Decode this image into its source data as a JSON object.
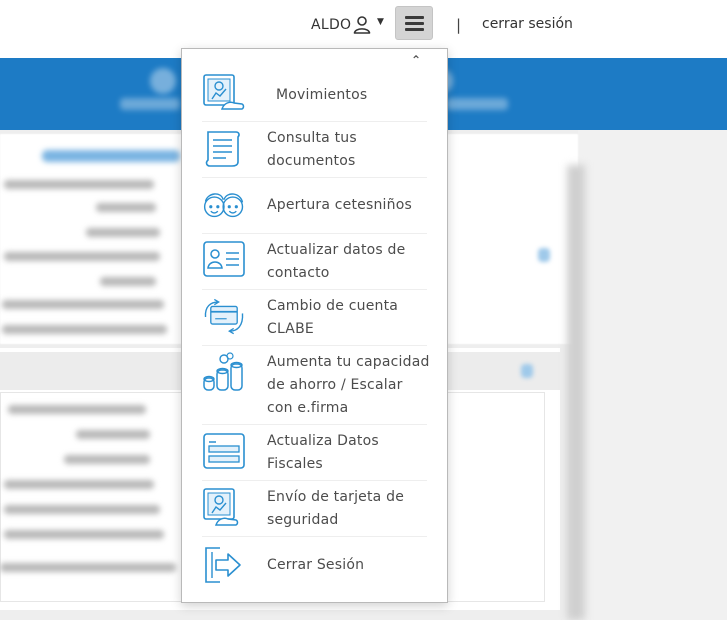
{
  "header": {
    "user_name": "ALDO",
    "user_icon": "user-icon",
    "dropdown_icon": "caret-down-icon",
    "menu_icon": "hamburger-menu-icon",
    "separator": "|",
    "logout_label": "cerrar sesión"
  },
  "menu": {
    "collapse_icon": "double-chevron-up-icon",
    "items": [
      {
        "label": "Movimientos",
        "icon": "movements-card-icon"
      },
      {
        "label": "Consulta tus documentos",
        "icon": "document-scroll-icon"
      },
      {
        "label": "Apertura cetesniños",
        "icon": "children-faces-icon"
      },
      {
        "label": "Actualizar datos de contacto",
        "icon": "contact-card-icon"
      },
      {
        "label": "Cambio de cuenta CLABE",
        "icon": "card-exchange-icon"
      },
      {
        "label": "Aumenta tu capacidad de ahorro / Escalar con e.firma",
        "icon": "coin-stacks-icon"
      },
      {
        "label": "Actualiza Datos Fiscales",
        "icon": "fiscal-form-icon"
      },
      {
        "label": "Envío de tarjeta de seguridad",
        "icon": "security-card-icon"
      },
      {
        "label": "Cerrar Sesión",
        "icon": "exit-door-icon"
      }
    ]
  },
  "colors": {
    "accent_blue": "#1d7bc5",
    "icon_blue": "#2a8fd0",
    "menu_text": "#4c4c4c"
  }
}
